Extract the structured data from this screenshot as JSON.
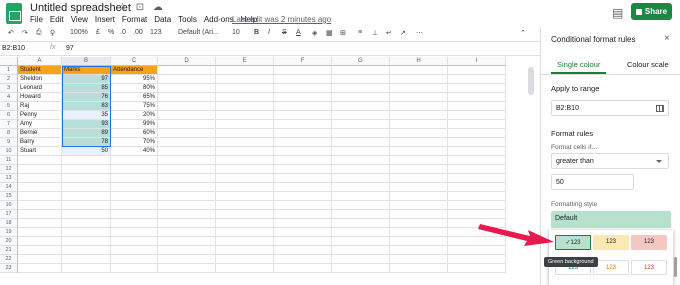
{
  "doc": {
    "title": "Untitled spreadsheet",
    "title_icons": "☆ ⊡ ☁",
    "last_edit": "Last edit was 2 minutes ago",
    "share_label": "Share"
  },
  "menu": [
    "File",
    "Edit",
    "View",
    "Insert",
    "Format",
    "Data",
    "Tools",
    "Add-ons",
    "Help"
  ],
  "toolbar": {
    "undo": "↶",
    "redo": "↷",
    "print": "⎙",
    "paint": "⚲",
    "zoom": "100%",
    "currency": "£",
    "percent": "%",
    "dec_less": ".0",
    "dec_more": ".00",
    "format_more": "123",
    "font": "Default (Ari...",
    "font_size": "10",
    "bold": "B",
    "italic": "I",
    "strike": "S",
    "text_color": "A",
    "more": "⋯"
  },
  "formula_bar": {
    "name_box": "B2:B10",
    "fx": "fx",
    "value": "97"
  },
  "grid": {
    "columns": [
      "A",
      "B",
      "C",
      "D",
      "E",
      "F",
      "G",
      "H",
      "I"
    ],
    "rows": [
      "1",
      "2",
      "3",
      "4",
      "5",
      "6",
      "7",
      "8",
      "9",
      "10",
      "11",
      "12",
      "13",
      "14",
      "15",
      "16",
      "17",
      "18",
      "19",
      "20",
      "21",
      "22",
      "23"
    ],
    "header": [
      "Student",
      "Marks",
      "Attendance"
    ],
    "data": [
      {
        "student": "Sheldon",
        "marks": "97",
        "attendance": "95%"
      },
      {
        "student": "Leonard",
        "marks": "85",
        "attendance": "80%"
      },
      {
        "student": "Howard",
        "marks": "76",
        "attendance": "65%"
      },
      {
        "student": "Raj",
        "marks": "83",
        "attendance": "75%"
      },
      {
        "student": "Penny",
        "marks": "35",
        "attendance": "20%"
      },
      {
        "student": "Amy",
        "marks": "93",
        "attendance": "99%"
      },
      {
        "student": "Bernie",
        "marks": "89",
        "attendance": "60%"
      },
      {
        "student": "Barry",
        "marks": "78",
        "attendance": "70%"
      },
      {
        "student": "Stuart",
        "marks": "50",
        "attendance": "40%"
      }
    ]
  },
  "sidebar": {
    "title": "Conditional format rules",
    "close": "×",
    "tabs": [
      "Single colour",
      "Colour scale"
    ],
    "apply_label": "Apply to range",
    "range": "B2:B10",
    "rules_label": "Format rules",
    "format_if_label": "Format cells if…",
    "condition": "greater than",
    "value": "50",
    "style_label": "Formatting style",
    "default_label": "Default",
    "swatches": [
      {
        "label": "✓123",
        "bg": "#b7e1cd",
        "fg": "#202124"
      },
      {
        "label": "123",
        "bg": "#fce8b2",
        "fg": "#202124"
      },
      {
        "label": "123",
        "bg": "#f4c7c3",
        "fg": "#202124"
      },
      {
        "label": "123",
        "bg": "#ffffff",
        "fg": "#188038"
      },
      {
        "label": "123",
        "bg": "#ffffff",
        "fg": "#e37400"
      },
      {
        "label": "123",
        "bg": "#ffffff",
        "fg": "#d93025"
      }
    ],
    "tooltip": "Green background"
  },
  "colors": {
    "header_orange": "#f6a21a",
    "green_fill": "#b7ded8",
    "share_green": "#1a8744",
    "arrow_red": "#e8194f"
  }
}
